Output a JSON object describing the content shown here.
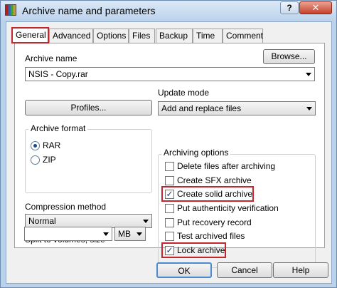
{
  "window": {
    "title": "Archive name and parameters",
    "help_glyph": "?",
    "close_glyph": "✕"
  },
  "tabs": [
    {
      "label": "General",
      "active": true
    },
    {
      "label": "Advanced"
    },
    {
      "label": "Options"
    },
    {
      "label": "Files"
    },
    {
      "label": "Backup"
    },
    {
      "label": "Time"
    },
    {
      "label": "Comment"
    }
  ],
  "general": {
    "archive_name_label": "Archive name",
    "browse_label": "Browse...",
    "archive_name_value": "NSIS - Copy.rar",
    "profiles_label": "Profiles...",
    "update_mode_label": "Update mode",
    "update_mode_value": "Add and replace files",
    "archive_format": {
      "title": "Archive format",
      "options": [
        {
          "label": "RAR",
          "selected": true
        },
        {
          "label": "ZIP",
          "selected": false
        }
      ]
    },
    "compression_label": "Compression method",
    "compression_value": "Normal",
    "split_label": "Split to volumes, size",
    "split_value": "",
    "split_unit": "MB",
    "archiving_options": {
      "title": "Archiving options",
      "items": [
        {
          "label": "Delete files after archiving",
          "checked": false
        },
        {
          "label": "Create SFX archive",
          "checked": false
        },
        {
          "label": "Create solid archive",
          "checked": true
        },
        {
          "label": "Put authenticity verification",
          "checked": false
        },
        {
          "label": "Put recovery record",
          "checked": false
        },
        {
          "label": "Test archived files",
          "checked": false
        },
        {
          "label": "Lock archive",
          "checked": true
        }
      ]
    }
  },
  "buttons": {
    "ok": "OK",
    "cancel": "Cancel",
    "help": "Help"
  },
  "colors": {
    "highlight": "#c0282e",
    "titlebar": "#bcd3ec"
  }
}
